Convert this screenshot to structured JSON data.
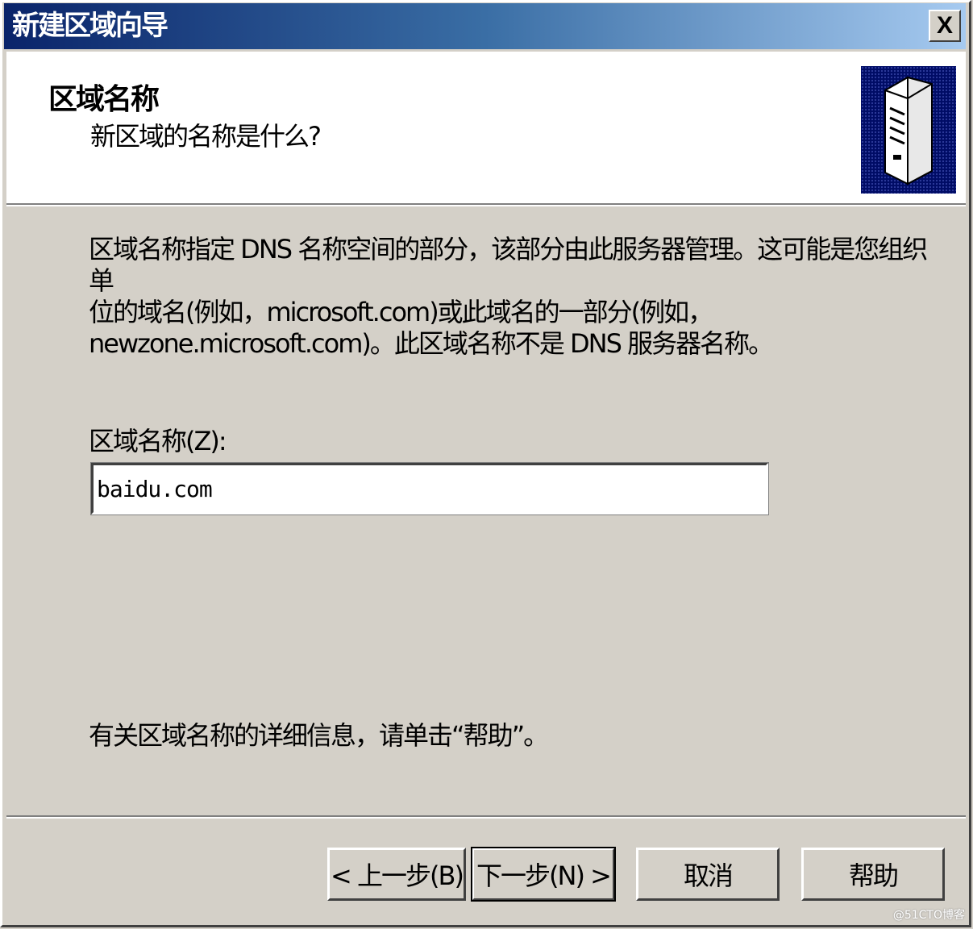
{
  "window": {
    "title": "新建区域向导",
    "close_label": "X"
  },
  "header": {
    "title": "区域名称",
    "subtitle": "新区域的名称是什么?",
    "icon": "server-icon"
  },
  "body": {
    "description_lines": [
      "区域名称指定 DNS 名称空间的部分，该部分由此服务器管理。这可能是您组织单",
      "位的域名(例如，microsoft.com)或此域名的一部分(例如，",
      "newzone.microsoft.com)。此区域名称不是 DNS 服务器名称。"
    ],
    "field_label": "区域名称(Z):",
    "zone_name_value": "baidu.com",
    "help_note": "有关区域名称的详细信息，请单击“帮助”。"
  },
  "buttons": {
    "back": "< 上一步(B)",
    "next": "下一步(N) >",
    "cancel": "取消",
    "help": "帮助"
  },
  "watermark": "@51CTO博客",
  "colors": {
    "dialog_bg": "#d4d0c8",
    "title_gradient_start": "#0a246a",
    "title_gradient_end": "#a6caf0",
    "icon_bg": "#000c66"
  }
}
